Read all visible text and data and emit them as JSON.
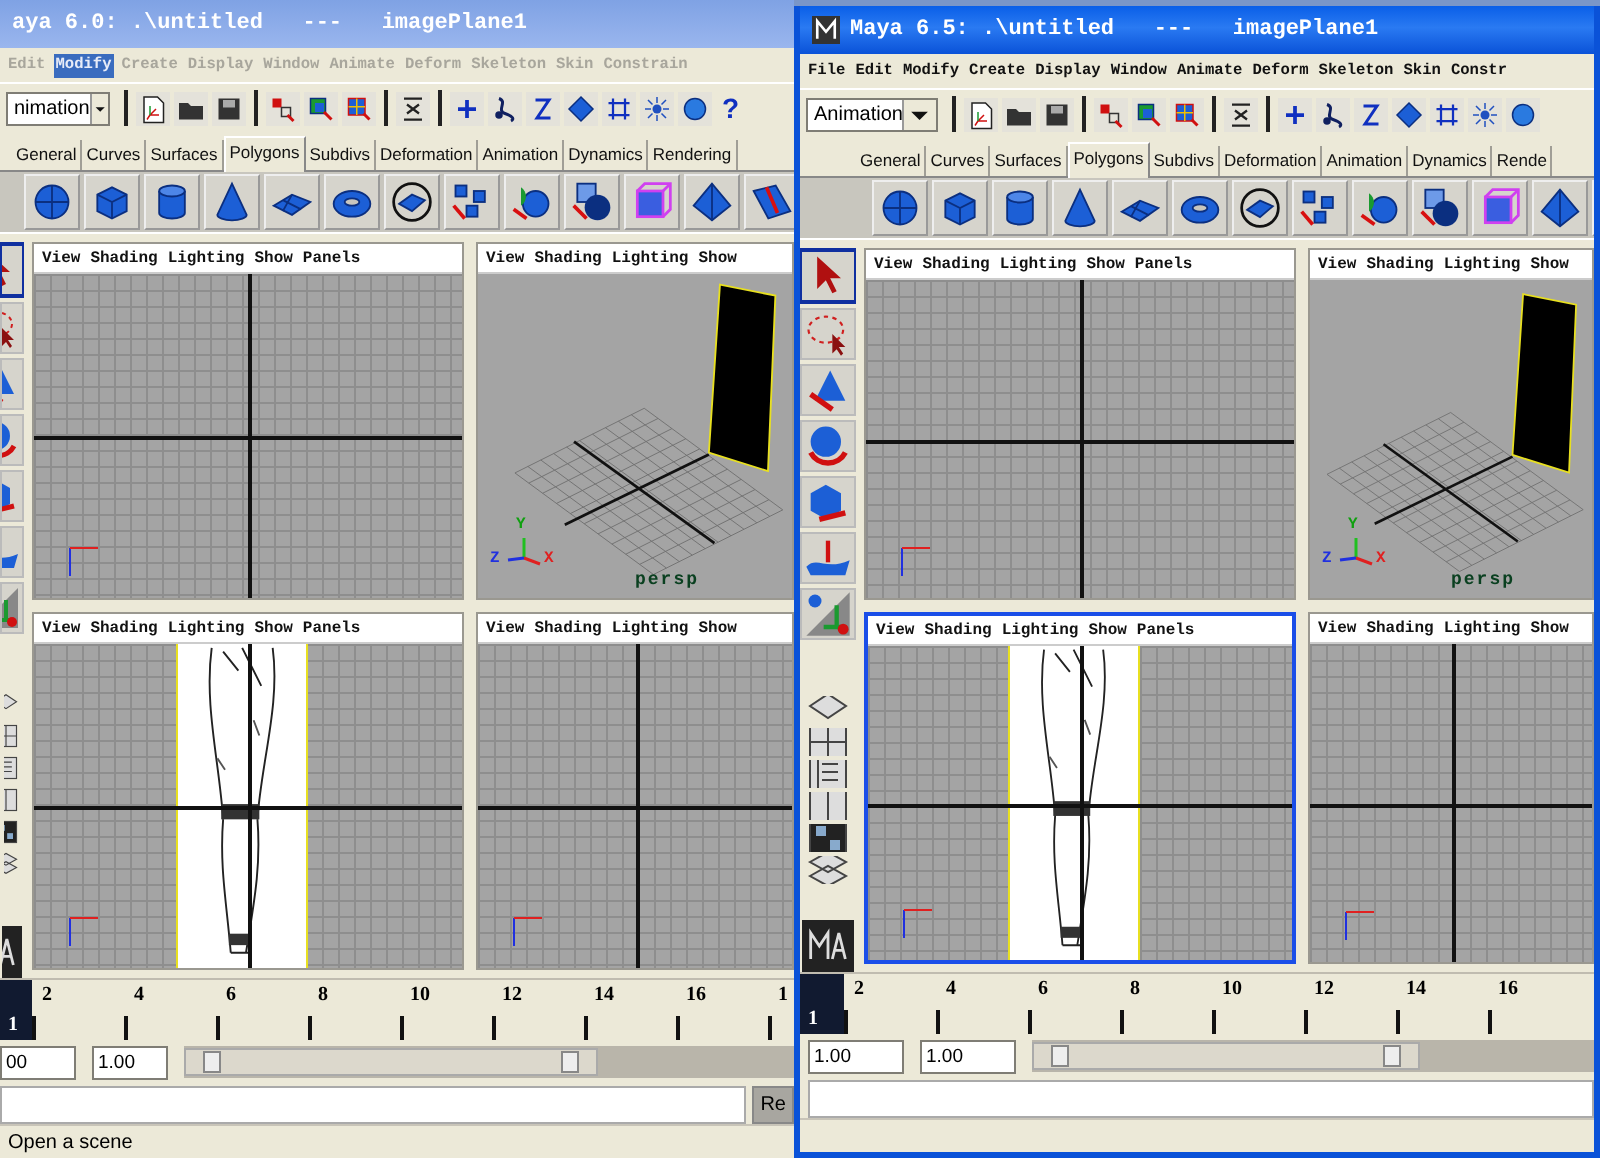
{
  "windows": [
    {
      "title": "aya 6.0: .\\untitled   ---   imagePlane1",
      "active": false,
      "menus": [
        {
          "label": "Edit",
          "selected": false
        },
        {
          "label": "Modify",
          "selected": true
        },
        {
          "label": "Create",
          "selected": false
        },
        {
          "label": "Display",
          "selected": false
        },
        {
          "label": "Window",
          "selected": false
        },
        {
          "label": "Animate",
          "selected": false
        },
        {
          "label": "Deform",
          "selected": false
        },
        {
          "label": "Skeleton",
          "selected": false
        },
        {
          "label": "Skin",
          "selected": false
        },
        {
          "label": "Constrain",
          "selected": false
        }
      ],
      "mode": "nimation",
      "help_glyph": "?",
      "shelf_tabs": [
        {
          "label": "General",
          "selected": false
        },
        {
          "label": "Curves",
          "selected": false
        },
        {
          "label": "Surfaces",
          "selected": false
        },
        {
          "label": "Polygons",
          "selected": true
        },
        {
          "label": "Subdivs",
          "selected": false
        },
        {
          "label": "Deformation",
          "selected": false
        },
        {
          "label": "Animation",
          "selected": false
        },
        {
          "label": "Dynamics",
          "selected": false
        },
        {
          "label": "Rendering",
          "selected": false
        }
      ],
      "viewports": [
        {
          "kind": "ortho",
          "selected": false,
          "menus": [
            "View",
            "Shading",
            "Lighting",
            "Show",
            "Panels"
          ]
        },
        {
          "kind": "persp",
          "selected": false,
          "menus": [
            "View",
            "Shading",
            "Lighting",
            "Show"
          ],
          "camera_label": "persp",
          "axis_labels": [
            "Y",
            "Z",
            "X"
          ]
        },
        {
          "kind": "image_plane",
          "selected": false,
          "menus": [
            "View",
            "Shading",
            "Lighting",
            "Show",
            "Panels"
          ]
        },
        {
          "kind": "ortho",
          "selected": false,
          "menus": [
            "View",
            "Shading",
            "Lighting",
            "Show"
          ]
        }
      ],
      "timeline": {
        "current_frame": "1",
        "ticks": [
          "2",
          "4",
          "6",
          "8",
          "10",
          "12",
          "14",
          "16",
          "1"
        ]
      },
      "range_fields": [
        "00",
        "1.00"
      ],
      "range_slider": {
        "level": 0.68
      },
      "command_button": "Re",
      "help_line": "Open a scene"
    },
    {
      "title": "Maya 6.5: .\\untitled   ---   imagePlane1",
      "active": true,
      "menus": [
        {
          "label": "File",
          "selected": false
        },
        {
          "label": "Edit",
          "selected": false
        },
        {
          "label": "Modify",
          "selected": false
        },
        {
          "label": "Create",
          "selected": false
        },
        {
          "label": "Display",
          "selected": false
        },
        {
          "label": "Window",
          "selected": false
        },
        {
          "label": "Animate",
          "selected": false
        },
        {
          "label": "Deform",
          "selected": false
        },
        {
          "label": "Skeleton",
          "selected": false
        },
        {
          "label": "Skin",
          "selected": false
        },
        {
          "label": "Constr",
          "selected": false
        }
      ],
      "mode": "Animation",
      "shelf_tabs": [
        {
          "label": "General",
          "selected": false
        },
        {
          "label": "Curves",
          "selected": false
        },
        {
          "label": "Surfaces",
          "selected": false
        },
        {
          "label": "Polygons",
          "selected": true
        },
        {
          "label": "Subdivs",
          "selected": false
        },
        {
          "label": "Deformation",
          "selected": false
        },
        {
          "label": "Animation",
          "selected": false
        },
        {
          "label": "Dynamics",
          "selected": false
        },
        {
          "label": "Rende",
          "selected": false
        }
      ],
      "viewports": [
        {
          "kind": "ortho",
          "selected": false,
          "menus": [
            "View",
            "Shading",
            "Lighting",
            "Show",
            "Panels"
          ]
        },
        {
          "kind": "persp",
          "selected": false,
          "menus": [
            "View",
            "Shading",
            "Lighting",
            "Show"
          ],
          "camera_label": "persp",
          "axis_labels": [
            "Y",
            "Z",
            "X"
          ]
        },
        {
          "kind": "image_plane",
          "selected": true,
          "menus": [
            "View",
            "Shading",
            "Lighting",
            "Show",
            "Panels"
          ]
        },
        {
          "kind": "ortho",
          "selected": false,
          "menus": [
            "View",
            "Shading",
            "Lighting",
            "Show"
          ]
        }
      ],
      "timeline": {
        "current_frame": "1",
        "ticks": [
          "2",
          "4",
          "6",
          "8",
          "10",
          "12",
          "14",
          "16"
        ]
      },
      "range_fields": [
        "1.00",
        "1.00"
      ],
      "range_slider": {
        "level": 0.69
      }
    }
  ]
}
